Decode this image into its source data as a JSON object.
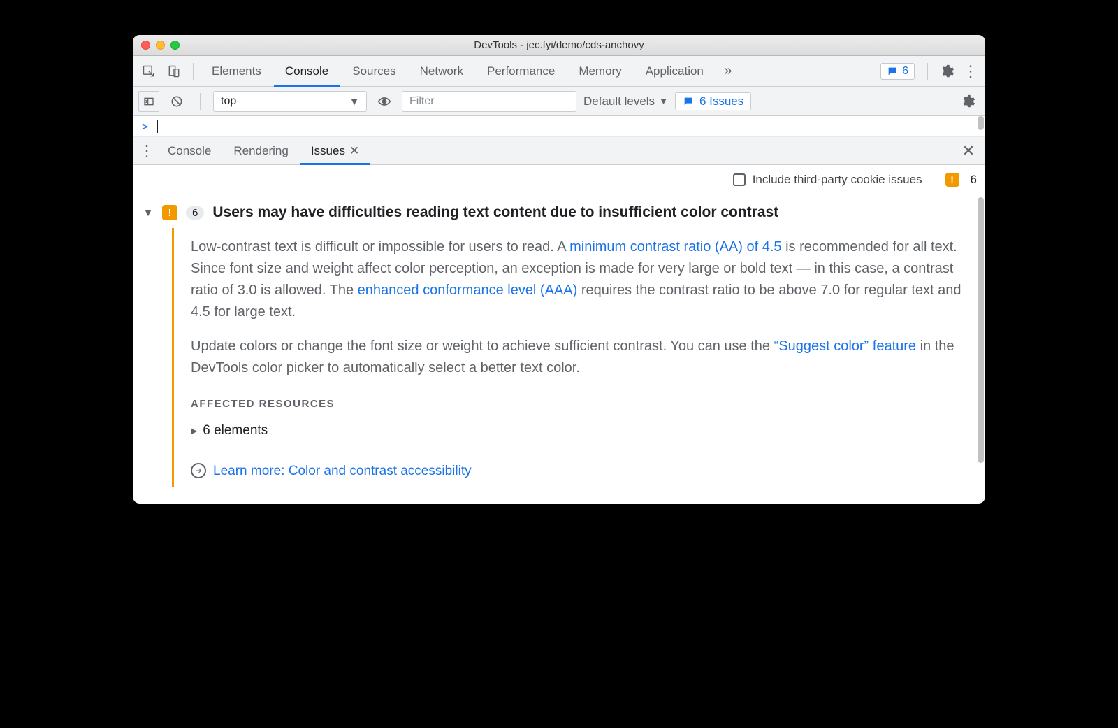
{
  "window": {
    "title": "DevTools - jec.fyi/demo/cds-anchovy"
  },
  "tabs": {
    "items": [
      "Elements",
      "Console",
      "Sources",
      "Network",
      "Performance",
      "Memory",
      "Application"
    ],
    "active": "Console",
    "overflow": "»",
    "issues_count": "6"
  },
  "subbar": {
    "context": "top",
    "filter_placeholder": "Filter",
    "levels": "Default levels",
    "issues_link": "6 Issues"
  },
  "console": {
    "prompt": ">"
  },
  "drawer_tabs": {
    "items": [
      "Console",
      "Rendering",
      "Issues"
    ],
    "active": "Issues"
  },
  "issuebar": {
    "include_label": "Include third-party cookie issues",
    "warn_count": "6"
  },
  "issue": {
    "count": "6",
    "title": "Users may have difficulties reading text content due to insufficient color contrast",
    "p1a": "Low-contrast text is difficult or impossible for users to read. A ",
    "link1": "minimum contrast ratio (AA) of 4.5",
    "p1b": " is recommended for all text. Since font size and weight affect color perception, an exception is made for very large or bold text — in this case, a contrast ratio of 3.0 is allowed. The ",
    "link2": "enhanced conformance level (AAA)",
    "p1c": " requires the contrast ratio to be above 7.0 for regular text and 4.5 for large text.",
    "p2a": "Update colors or change the font size or weight to achieve sufficient contrast. You can use the ",
    "link3": "“Suggest color” feature",
    "p2b": " in the DevTools color picker to automatically select a better text color.",
    "affected_header": "AFFECTED RESOURCES",
    "elements": "6 elements",
    "learn_more": "Learn more: Color and contrast accessibility"
  }
}
